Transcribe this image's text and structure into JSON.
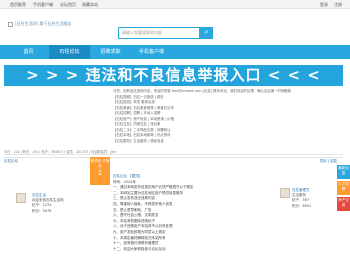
{
  "topbar": {
    "links": [
      "首页推荐",
      "手机客户端",
      "论坛首页",
      "收藏本站"
    ],
    "login": "登录",
    "register": "注册"
  },
  "header": {
    "logo_alt": "[石柱生活网] 属于石柱生活服务",
    "search_placeholder": "请输入您要搜索的内容",
    "search_icon": "search-icon"
  },
  "nav": {
    "items": [
      "首页",
      "石柱论坛",
      "招聘求职",
      "手机客户端"
    ],
    "active_index": 1
  },
  "banner": {
    "text": "> > > 违法和不良信息举报入口 < < <"
  },
  "info": {
    "rows": [
      "为您，如有违法违规内容，请及时举报 free@shmed.com [石柱] 联系本站，我们将及时处理，确认后会第一时间删除",
      "【石柱视频】石柱一日旅游 | 精彩",
      "【石柱旅游】转发 集体出游",
      "【石柱美食】石柱美食推荐 | 美食共分享",
      "【石柱招聘】招聘 | 本地人招聘",
      "【石柱房产】房产信息 | 本地房源 | 价格",
      "【石柱交友】同城交友 | 找对象",
      "【石柱二手】二手物品交易 | 闲置转让",
      "【石柱本地】石柱本地新闻 | 热点资讯",
      "【石柱服务】生活服务 | 便民信息"
    ]
  },
  "stats": {
    "text": "今日：102 | 昨日：161 | 帖子：305627 | 会员：201757 | 欢迎新会员：jytc"
  },
  "section": {
    "title": "石柱论坛",
    "right": "发帖 | 回复"
  },
  "sidebar": {
    "buttons": [
      {
        "label": "最新回复",
        "color": "#29a8e0"
      },
      {
        "label": "人才招聘",
        "color": "#ff9b2f"
      },
      {
        "label": "房产交易",
        "color": "#e8483c"
      }
    ]
  },
  "badge": {
    "label": "精华帖 子版块",
    "rank": "1"
  },
  "post": {
    "header": "石柱论坛 【置顶】",
    "lines": [
      "时间：2024年",
      "一、通过本网发布信息的用户必须严格遵守以下规定",
      "二、本网站主要为石柱地区用户提供信息服务",
      "三、禁止发布违法违规内容",
      "四、尊重他人隐私，不得发布他人信息",
      "五、禁止恶意刷帖、广告",
      "六、遵守社会公德，文明发言",
      "七、本站有权删除违规帖子",
      "八、对于违规用户本站将予以封号处理",
      "九、用户发帖即视为同意以上规定",
      "十、本规定最终解释权归本站所有",
      "十一、如有疑问请联系管理员",
      "十二、欢迎大家积极参与论坛互动"
    ]
  },
  "user_left": {
    "name": "石柱生活",
    "desc": "欢迎来到石柱生活网",
    "posts": "帖子：1234",
    "score": "积分：5678"
  },
  "user_right": {
    "name": "石柱管理员",
    "desc": "生活服务",
    "posts": "帖子：567",
    "score": "积分：8901"
  },
  "pager": {
    "text": "1 2 3 4 5 ... 下一页"
  }
}
